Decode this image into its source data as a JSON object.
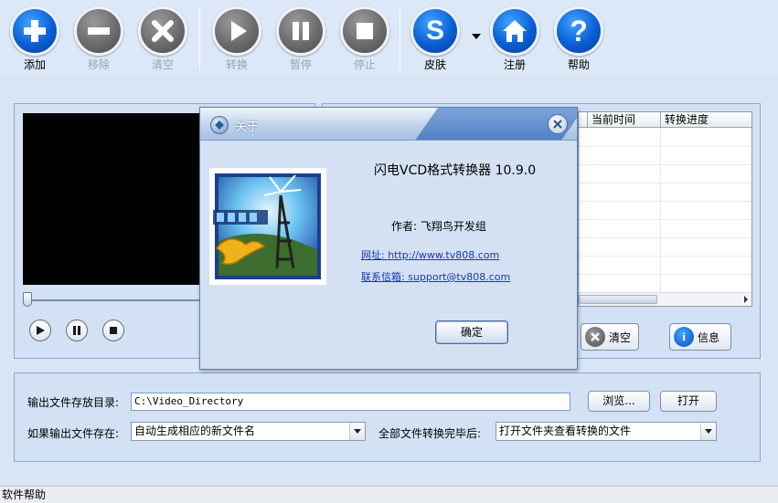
{
  "toolbar": {
    "add": "添加",
    "remove": "移除",
    "clear": "清空",
    "convert": "转换",
    "pause": "暂停",
    "stop": "停止",
    "skin": "皮肤",
    "register": "注册",
    "help": "帮助",
    "skin_icon_letter": "S",
    "help_icon_glyph": "?"
  },
  "icons": {
    "add": "plus-icon",
    "remove": "minus-icon",
    "clear": "x-icon",
    "convert": "play-icon",
    "pause": "pause-icon",
    "stop": "stop-icon",
    "skin": "skin-icon",
    "register": "home-icon",
    "help": "question-icon"
  },
  "colors": {
    "active_button": "#0a5fd6",
    "disabled_button": "#6c6c6c",
    "background": "#d9e5f5",
    "link": "#1637b9"
  },
  "file_list": {
    "columns": [
      "当前时间",
      "转换进度"
    ]
  },
  "list_actions": {
    "clear": "清空",
    "info": "信息",
    "info_icon_glyph": "i"
  },
  "output": {
    "dir_label": "输出文件存放目录:",
    "dir_value": "C:\\Video_Directory",
    "browse": "浏览...",
    "open": "打开",
    "exists_label": "如果输出文件存在:",
    "exists_value": "自动生成相应的新文件名",
    "done_label": "全部文件转换完毕后:",
    "done_value": "打开文件夹查看转换的文件"
  },
  "status": {
    "text": "软件帮助"
  },
  "about": {
    "title": "关于",
    "app_name": "闪电VCD格式转换器 10.9.0",
    "author": "作者: 飞翔鸟开发组",
    "website": "网址: http://www.tv808.com",
    "email": "联系信箱: support@tv808.com",
    "ok": "确定"
  }
}
